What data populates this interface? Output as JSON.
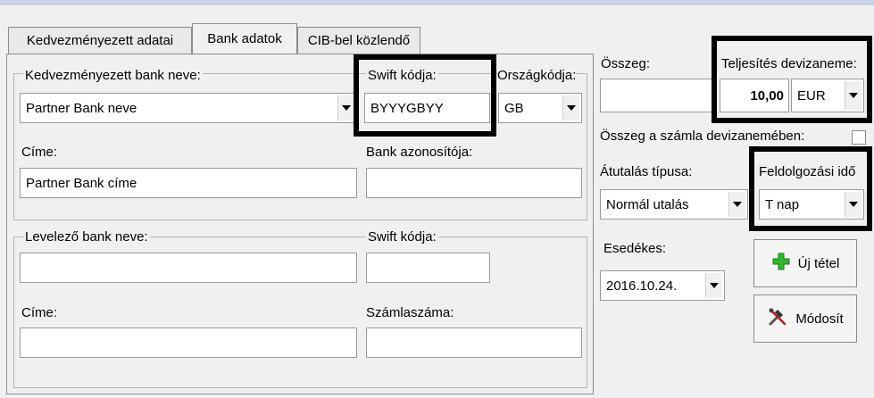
{
  "tabs": [
    "Kedvezményezett adatai",
    "Bank adatok",
    "CIB-bel közlendő"
  ],
  "bank": {
    "name_label": "Kedvezményezett bank neve:",
    "name_value": "Partner Bank neve",
    "swift_label": "Swift kódja:",
    "swift_value": "BYYYGBYY",
    "country_label": "Országkódja:",
    "country_value": "GB",
    "address_label": "Címe:",
    "address_value": "Partner Bank címe",
    "bank_id_label": "Bank azonosítója:",
    "bank_id_value": ""
  },
  "corr": {
    "name_label": "Levelező bank neve:",
    "name_value": "",
    "swift_label": "Swift kódja:",
    "swift_value": "",
    "address_label": "Címe:",
    "address_value": "",
    "account_label": "Számlaszáma:",
    "account_value": ""
  },
  "right": {
    "amount_label": "Összeg:",
    "amount_value": "",
    "currency_label": "Teljesítés devizaneme:",
    "currency_amount": "10,00",
    "currency_value": "EUR",
    "account_currency_label": "Összeg a számla devizanemében:",
    "transfer_type_label": "Átutalás típusa:",
    "transfer_type_value": "Normál utalás",
    "processing_label": "Feldolgozási idő",
    "processing_value": "T nap",
    "due_label": "Esedékes:",
    "due_value": "2016.10.24.",
    "new_item_button": "Új tétel",
    "modify_button": "Módosít"
  },
  "colors": {
    "highlight": "#000000",
    "plus_icon": "#2db82d",
    "top_strip": "#c7d3e6"
  }
}
